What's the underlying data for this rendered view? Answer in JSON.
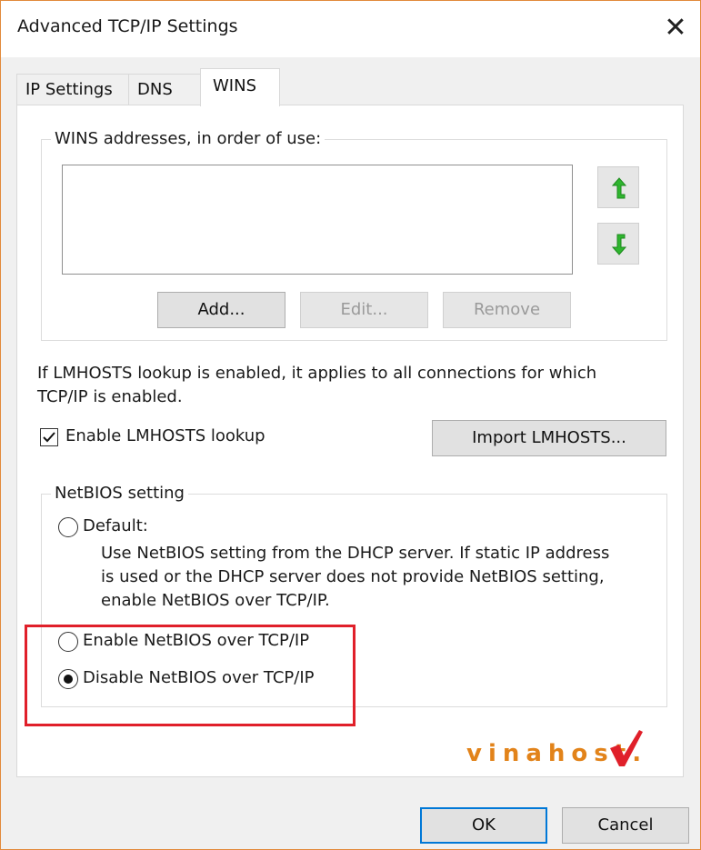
{
  "window": {
    "title": "Advanced TCP/IP Settings",
    "close_symbol": "✕"
  },
  "tabs": [
    {
      "label": "IP Settings",
      "active": false
    },
    {
      "label": "DNS",
      "active": false
    },
    {
      "label": "WINS",
      "active": true
    }
  ],
  "wins": {
    "group_label": "WINS addresses, in order of use:",
    "addresses": [],
    "buttons": {
      "add": "Add...",
      "edit": "Edit...",
      "remove": "Remove"
    },
    "move_up_icon": "arrow-up-icon",
    "move_down_icon": "arrow-down-icon"
  },
  "lmhosts": {
    "info_line1": "If LMHOSTS lookup is enabled, it applies to all connections for which",
    "info_line2": "TCP/IP is enabled.",
    "enable_label": "Enable LMHOSTS lookup",
    "enable_checked": true,
    "import_button": "Import LMHOSTS..."
  },
  "netbios": {
    "group_label": "NetBIOS setting",
    "default_label": "Default:",
    "default_desc_line1": "Use NetBIOS setting from the DHCP server. If static IP address",
    "default_desc_line2": "is used or the DHCP server does not provide NetBIOS setting,",
    "default_desc_line3": "enable NetBIOS over TCP/IP.",
    "enable_label": "Enable NetBIOS over TCP/IP",
    "disable_label": "Disable NetBIOS over TCP/IP",
    "selected": "disable"
  },
  "footer": {
    "ok": "OK",
    "cancel": "Cancel"
  },
  "watermark": {
    "text": "vinahost."
  },
  "colors": {
    "highlight_border": "#e0202a",
    "arrow_green": "#2fb52f",
    "default_button_border": "#0078d7",
    "watermark": "#e2831a"
  }
}
